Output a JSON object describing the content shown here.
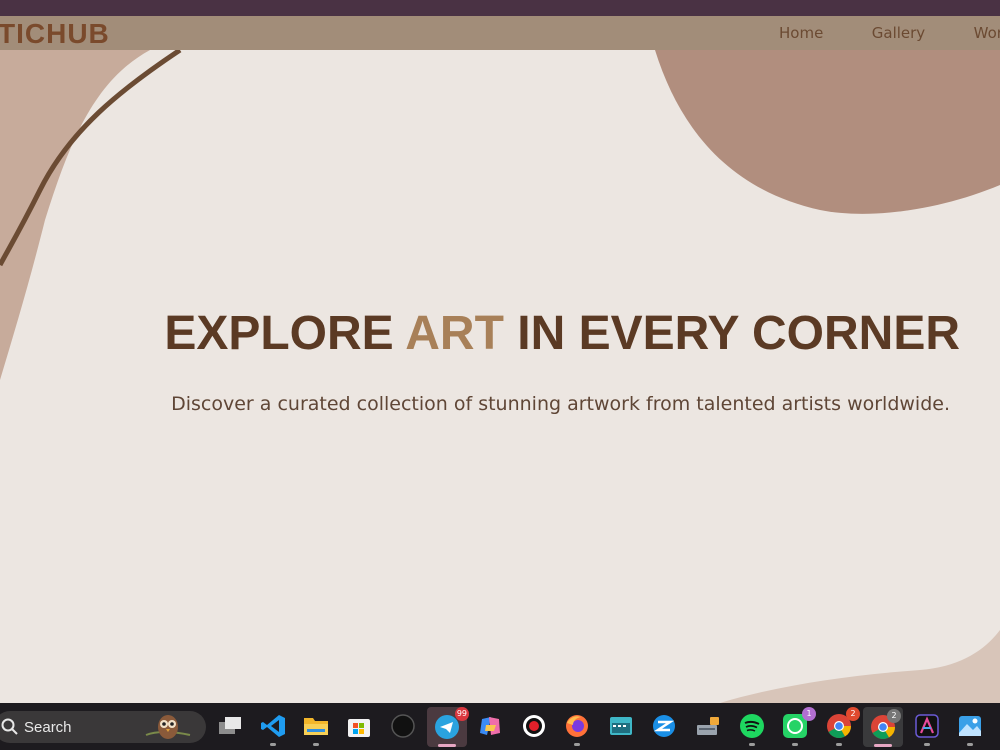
{
  "site": {
    "brand": "TICHUB",
    "nav": [
      "Home",
      "Gallery",
      "Work"
    ]
  },
  "hero": {
    "headline_part1": "EXPLORE ",
    "headline_accent": "ART",
    "headline_part2": " IN EVERY CORNER",
    "subtitle": "Discover a curated collection of stunning artwork from talented artists worldwide."
  },
  "taskbar": {
    "search_placeholder": "Search",
    "apps": [
      {
        "name": "task-view-icon"
      },
      {
        "name": "vscode-icon"
      },
      {
        "name": "file-explorer-icon"
      },
      {
        "name": "microsoft-store-icon"
      },
      {
        "name": "circle-app-icon"
      },
      {
        "name": "telegram-icon",
        "badge": "99"
      },
      {
        "name": "copilot-icon"
      },
      {
        "name": "screen-recorder-icon"
      },
      {
        "name": "firefox-icon"
      },
      {
        "name": "keyboard-app-icon"
      },
      {
        "name": "stack-app-icon"
      },
      {
        "name": "vpn-keyboard-icon"
      },
      {
        "name": "spotify-icon"
      },
      {
        "name": "whatsapp-icon",
        "badge": "1"
      },
      {
        "name": "chrome-icon",
        "badge": "2"
      },
      {
        "name": "chrome-profile-icon",
        "badge": "2"
      },
      {
        "name": "affinity-icon"
      },
      {
        "name": "photos-icon"
      }
    ]
  },
  "colors": {
    "navbar": "#a28d79",
    "brand": "#7a4a2c",
    "headline": "#5b3a24",
    "accent": "#a88058",
    "background": "#ece6e1",
    "taskbar": "#1d1b1f"
  }
}
